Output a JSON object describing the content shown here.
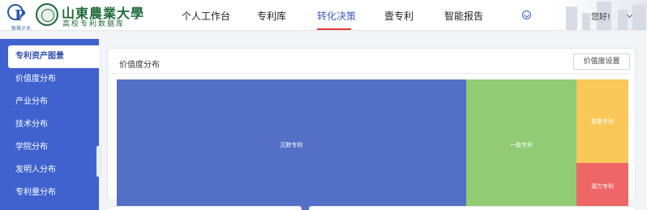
{
  "header": {
    "logo_sub": "智慧之光",
    "university_name": "山東農業大學",
    "university_sub": "高校专利数据库",
    "nav": [
      {
        "label": "个人工作台",
        "active": false
      },
      {
        "label": "专利库",
        "active": false
      },
      {
        "label": "转化决策",
        "active": true
      },
      {
        "label": "壹专利",
        "active": false
      },
      {
        "label": "智能报告",
        "active": false
      }
    ],
    "greeting": "您好!"
  },
  "sidebar": {
    "items": [
      {
        "label": "专利资产图景",
        "active": true
      },
      {
        "label": "价值度分布",
        "active": false
      },
      {
        "label": "产业分布",
        "active": false
      },
      {
        "label": "技术分布",
        "active": false
      },
      {
        "label": "学院分布",
        "active": false
      },
      {
        "label": "发明人分布",
        "active": false
      },
      {
        "label": "专利量分布",
        "active": false
      }
    ]
  },
  "panel": {
    "title": "价值度分布",
    "settings_button": "价值度设置"
  },
  "treemap": {
    "items": [
      {
        "label": "沉默专利",
        "color": "#5470c6"
      },
      {
        "label": "一般专利",
        "color": "#91cc75"
      },
      {
        "label": "重要专利",
        "color": "#fac858"
      },
      {
        "label": "潜力专利",
        "color": "#ee6666"
      }
    ]
  }
}
